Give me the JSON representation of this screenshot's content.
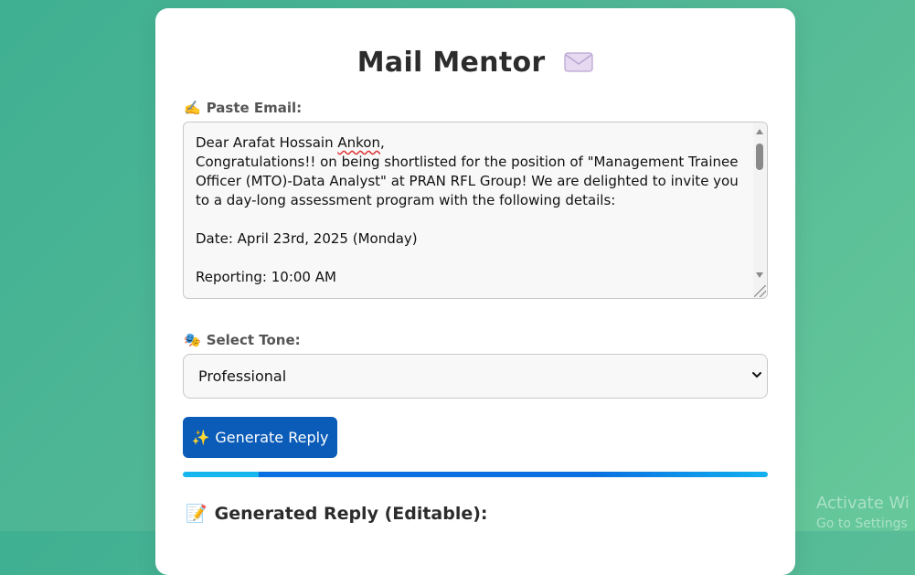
{
  "app": {
    "title": "Mail Mentor",
    "title_icon": "envelope-icon"
  },
  "email_section": {
    "label": "Paste Email:",
    "label_icon": "writing-hand-icon",
    "greeting_prefix": "Dear Arafat Hossain ",
    "greeting_name": "Ankon",
    "greeting_suffix": ",",
    "body": "\nCongratulations!! on being shortlisted for the position of \"Management Trainee Officer (MTO)-Data Analyst\" at PRAN RFL Group! We are delighted to invite you to a day-long assessment program with the following details:\n\nDate: April 23rd, 2025 (Monday)\n\nReporting: 10:00 AM"
  },
  "tone_section": {
    "label": "Select Tone:",
    "label_icon": "theater-masks-icon",
    "selected": "Professional"
  },
  "generate_button": {
    "label": "Generate Reply",
    "icon": "sparkles-icon"
  },
  "progress": {
    "visible": true
  },
  "reply_section": {
    "title": "Generated Reply (Editable):",
    "icon": "memo-icon"
  },
  "watermark": {
    "line1": "Activate Wi",
    "line2": "Go to Settings"
  },
  "colors": {
    "background": "#52b896",
    "card": "#ffffff",
    "button": "#0a5cb8",
    "progress": "#0a6fe0"
  }
}
